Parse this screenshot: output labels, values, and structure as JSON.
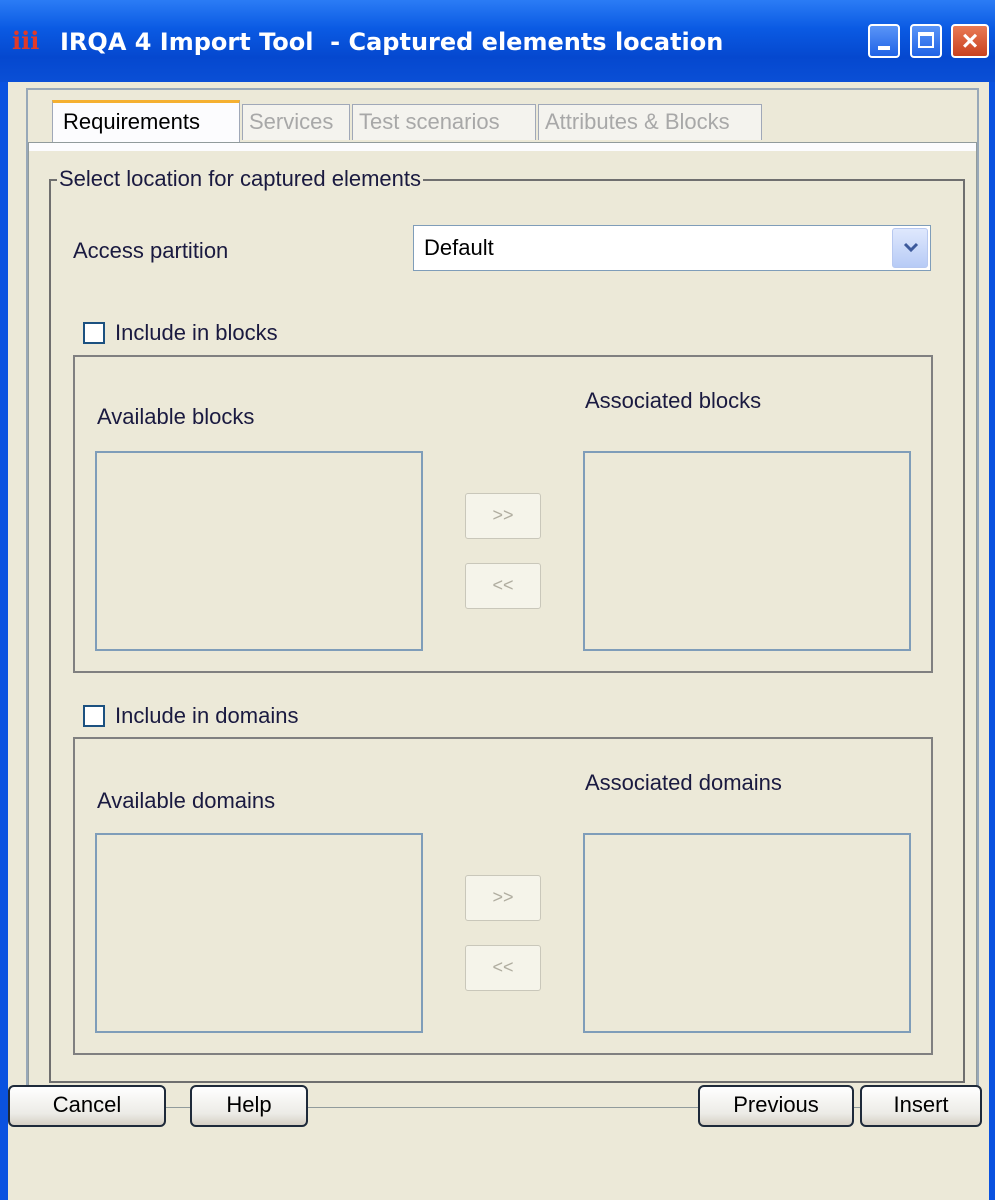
{
  "window": {
    "title": "IRQA 4 Import Tool  - Captured elements location",
    "icon": "irqa-app-icon",
    "controls": {
      "minimize": "minimize-icon",
      "maximize": "maximize-icon",
      "close": "×"
    }
  },
  "tabs": [
    {
      "label": "Requirements",
      "active": true
    },
    {
      "label": "Services",
      "active": false
    },
    {
      "label": "Test scenarios",
      "active": false
    },
    {
      "label": "Attributes & Blocks",
      "active": false
    }
  ],
  "group": {
    "legend": "Select location for captured elements",
    "access_partition": {
      "label": "Access partition",
      "value": "Default"
    },
    "blocks": {
      "checkbox_label": "Include in blocks",
      "checked": false,
      "available_label": "Available blocks",
      "associated_label": "Associated blocks",
      "add_label": ">>",
      "remove_label": "<<"
    },
    "domains": {
      "checkbox_label": "Include in domains",
      "checked": false,
      "available_label": "Available domains",
      "associated_label": "Associated domains",
      "add_label": ">>",
      "remove_label": "<<"
    }
  },
  "footer": {
    "cancel": "Cancel",
    "help": "Help",
    "previous": "Previous",
    "insert": "Insert"
  },
  "colors": {
    "titlebar": "#0a52e0",
    "dialog_bg": "#ece9d8",
    "active_tab_accent": "#f5b030"
  }
}
